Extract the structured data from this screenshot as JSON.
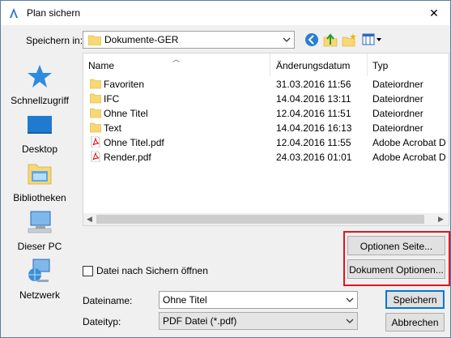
{
  "window": {
    "title": "Plan sichern",
    "close_glyph": "✕"
  },
  "location": {
    "label": "Speichern in:",
    "value": "Dokumente-GER"
  },
  "toolbar_icons": [
    "back-icon",
    "up-folder-icon",
    "new-folder-icon",
    "view-menu-icon"
  ],
  "sidebar": {
    "items": [
      {
        "label": "Schnellzugriff",
        "icon": "star-icon"
      },
      {
        "label": "Desktop",
        "icon": "desktop-icon"
      },
      {
        "label": "Bibliotheken",
        "icon": "libraries-icon"
      },
      {
        "label": "Dieser PC",
        "icon": "pc-icon"
      },
      {
        "label": "Netzwerk",
        "icon": "network-icon"
      }
    ]
  },
  "filelist": {
    "columns": [
      "Name",
      "Änderungsdatum",
      "Typ"
    ],
    "rows": [
      {
        "name": "Favoriten",
        "date": "31.03.2016 11:56",
        "type": "Dateiordner",
        "icon": "folder-icon"
      },
      {
        "name": "IFC",
        "date": "14.04.2016 13:11",
        "type": "Dateiordner",
        "icon": "folder-icon"
      },
      {
        "name": "Ohne Titel",
        "date": "12.04.2016 11:51",
        "type": "Dateiordner",
        "icon": "folder-icon"
      },
      {
        "name": "Text",
        "date": "14.04.2016 16:13",
        "type": "Dateiordner",
        "icon": "folder-icon"
      },
      {
        "name": "Ohne Titel.pdf",
        "date": "12.04.2016 11:55",
        "type": "Adobe Acrobat D",
        "icon": "pdf-icon"
      },
      {
        "name": "Render.pdf",
        "date": "24.03.2016 01:01",
        "type": "Adobe Acrobat D",
        "icon": "pdf-icon"
      }
    ]
  },
  "buttons": {
    "options_page": "Optionen Seite...",
    "document_options": "Dokument Optionen...",
    "save": "Speichern",
    "cancel": "Abbrechen"
  },
  "checkbox": {
    "label": "Datei nach Sichern öffnen",
    "checked": false
  },
  "filename": {
    "label": "Dateiname:",
    "value": "Ohne Titel"
  },
  "filetype": {
    "label": "Dateityp:",
    "value": "PDF Datei (*.pdf)"
  },
  "colors": {
    "folder": "#f8d775",
    "accent": "#0078d7",
    "highlight": "#e0141e"
  }
}
